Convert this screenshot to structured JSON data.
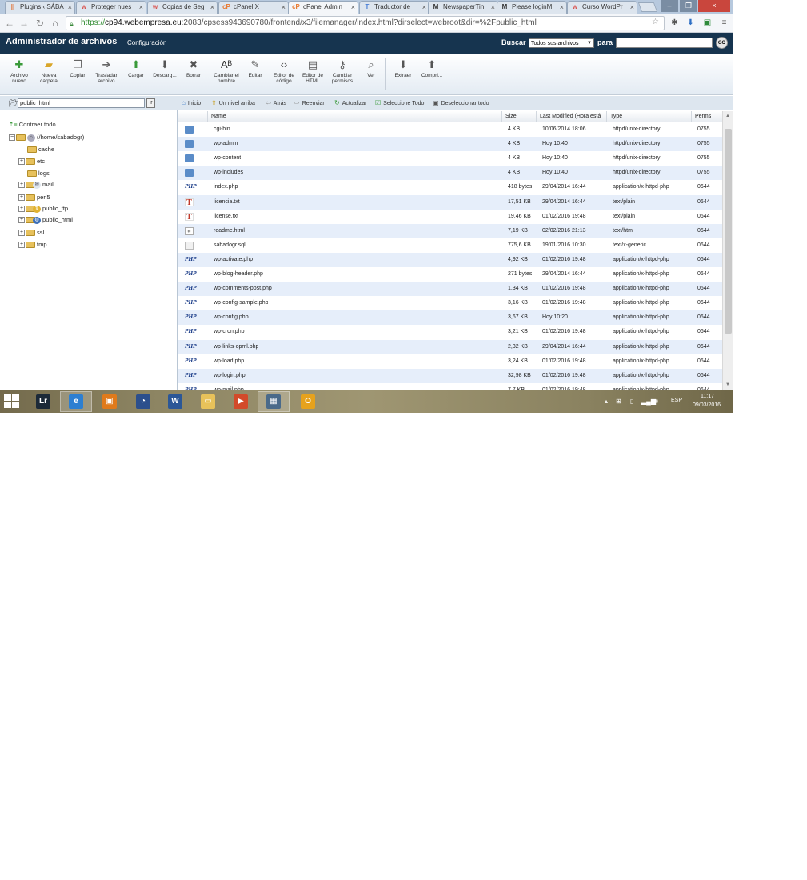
{
  "browser": {
    "tabs": [
      {
        "icon": "||",
        "label": "Plugins ‹ SÁBA",
        "icon_color": "#e26b2b"
      },
      {
        "icon": "w",
        "label": "Proteger nues",
        "icon_color": "#d9534f"
      },
      {
        "icon": "w",
        "label": "Copias de Seg",
        "icon_color": "#d9534f"
      },
      {
        "icon": "cP",
        "label": "cPanel X",
        "icon_color": "#e8772e"
      },
      {
        "icon": "cP",
        "label": "cPanel Admin",
        "icon_color": "#e8772e"
      },
      {
        "icon": "T",
        "label": "Traductor de",
        "icon_color": "#4a7fd6"
      },
      {
        "icon": "M",
        "label": "NewspaperTin",
        "icon_color": "#333333"
      },
      {
        "icon": "M",
        "label": "Please loginM",
        "icon_color": "#333333"
      },
      {
        "icon": "w",
        "label": "Curso WordPr",
        "icon_color": "#d9534f"
      }
    ],
    "active_tab": 4,
    "url": {
      "scheme": "https://",
      "host": "cp94.webempresa.eu",
      "path": ":2083/cpsess943690780/frontend/x3/filemanager/index.html?dirselect=webroot&dir=%2Fpublic_html"
    }
  },
  "header": {
    "title": "Administrador de archivos",
    "config_link": "Configuración",
    "search_label": "Buscar",
    "search_scope": "Todos sus archivos",
    "para_label": "para",
    "search_value": "",
    "go_label": "GO"
  },
  "toolbar": [
    {
      "name": "new-file",
      "label": "Archivo nuevo",
      "icon": "✚",
      "color": "#3a9a3a"
    },
    {
      "name": "new-folder",
      "label": "Nueva carpeta",
      "icon": "▰",
      "color": "#d9a62a"
    },
    {
      "name": "copy",
      "label": "Copiar",
      "icon": "❐",
      "color": "#666666"
    },
    {
      "name": "move-file",
      "label": "Trasladar archivo",
      "icon": "➔",
      "color": "#666666"
    },
    {
      "name": "upload",
      "label": "Cargar",
      "icon": "⬆",
      "color": "#3a9a3a"
    },
    {
      "name": "download",
      "label": "Descarg...",
      "icon": "⬇",
      "color": "#555555"
    },
    {
      "name": "delete",
      "label": "Borrar",
      "icon": "✖",
      "color": "#555555"
    },
    {
      "name": "rename",
      "label": "Cambiar el nombre",
      "icon": "Aᴮ",
      "color": "#333333"
    },
    {
      "name": "edit",
      "label": "Editar",
      "icon": "✎",
      "color": "#555555"
    },
    {
      "name": "code-editor",
      "label": "Editor de código",
      "icon": "‹›",
      "color": "#555555"
    },
    {
      "name": "html-editor",
      "label": "Editor de HTML",
      "icon": "▤",
      "color": "#555555"
    },
    {
      "name": "change-permissions",
      "label": "Cambiar permisos",
      "icon": "⚷",
      "color": "#555555"
    },
    {
      "name": "view",
      "label": "Ver",
      "icon": "⌕",
      "color": "#555555"
    },
    {
      "name": "extract",
      "label": "Extraer",
      "icon": "⬇",
      "color": "#555555"
    },
    {
      "name": "compress",
      "label": "Compri...",
      "icon": "⬆",
      "color": "#555555"
    }
  ],
  "left": {
    "dir_value": "public_html",
    "dir_go": "Ir",
    "collapse_all": "Contraer todo",
    "tree": [
      {
        "name": "home",
        "label": "(/home/sabadogr)",
        "level": 0,
        "exp": "−",
        "badge": ""
      },
      {
        "name": "cache",
        "label": "cache",
        "level": 1,
        "exp": "",
        "badge": ""
      },
      {
        "name": "etc",
        "label": "etc",
        "level": 1,
        "exp": "+",
        "badge": ""
      },
      {
        "name": "logs",
        "label": "logs",
        "level": 1,
        "exp": "",
        "badge": ""
      },
      {
        "name": "mail",
        "label": "mail",
        "level": 1,
        "exp": "+",
        "badge": "✉"
      },
      {
        "name": "perl5",
        "label": "perl5",
        "level": 1,
        "exp": "+",
        "badge": ""
      },
      {
        "name": "public-ftp",
        "label": "public_ftp",
        "level": 1,
        "exp": "+",
        "badge": "⇅"
      },
      {
        "name": "public-html",
        "label": "public_html",
        "level": 1,
        "exp": "+",
        "badge": "◍"
      },
      {
        "name": "ssl",
        "label": "ssl",
        "level": 1,
        "exp": "+",
        "badge": ""
      },
      {
        "name": "tmp",
        "label": "tmp",
        "level": 1,
        "exp": "+",
        "badge": ""
      }
    ]
  },
  "actions": [
    {
      "name": "home",
      "label": "Inicio",
      "icon": "⌂"
    },
    {
      "name": "up-one-level",
      "label": "Un nivel arriba",
      "icon": "⇧"
    },
    {
      "name": "back",
      "label": "Atrás",
      "icon": "⇦"
    },
    {
      "name": "forward",
      "label": "Reenviar",
      "icon": "⇨"
    },
    {
      "name": "refresh",
      "label": "Actualizar",
      "icon": "↻"
    },
    {
      "name": "select-all",
      "label": "Seleccione Todo",
      "icon": "☑"
    },
    {
      "name": "deselect-all",
      "label": "Deseleccionar todo",
      "icon": "▣"
    }
  ],
  "table": {
    "columns": [
      "Name",
      "Size",
      "Last Modified (Hora está",
      "Type",
      "Perms"
    ],
    "rows": [
      {
        "name": "cgi-bin",
        "size": "4 KB",
        "modified": "10/06/2014 18:06",
        "type": "httpd/unix-directory",
        "perms": "0755",
        "kind": "folder"
      },
      {
        "name": "wp-admin",
        "size": "4 KB",
        "modified": "Hoy 10:40",
        "type": "httpd/unix-directory",
        "perms": "0755",
        "kind": "folder"
      },
      {
        "name": "wp-content",
        "size": "4 KB",
        "modified": "Hoy 10:40",
        "type": "httpd/unix-directory",
        "perms": "0755",
        "kind": "folder"
      },
      {
        "name": "wp-includes",
        "size": "4 KB",
        "modified": "Hoy 10:40",
        "type": "httpd/unix-directory",
        "perms": "0755",
        "kind": "folder"
      },
      {
        "name": "index.php",
        "size": "418 bytes",
        "modified": "29/04/2014 16:44",
        "type": "application/x-httpd-php",
        "perms": "0644",
        "kind": "php"
      },
      {
        "name": "licencia.txt",
        "size": "17,51 KB",
        "modified": "29/04/2014 16:44",
        "type": "text/plain",
        "perms": "0644",
        "kind": "txt"
      },
      {
        "name": "license.txt",
        "size": "19,46 KB",
        "modified": "01/02/2016 19:48",
        "type": "text/plain",
        "perms": "0644",
        "kind": "txt"
      },
      {
        "name": "readme.html",
        "size": "7,19 KB",
        "modified": "02/02/2016 21:13",
        "type": "text/html",
        "perms": "0644",
        "kind": "html"
      },
      {
        "name": "sabadogr.sql",
        "size": "775,6 KB",
        "modified": "19/01/2016 10:30",
        "type": "text/x-generic",
        "perms": "0644",
        "kind": "sql"
      },
      {
        "name": "wp-activate.php",
        "size": "4,92 KB",
        "modified": "01/02/2016 19:48",
        "type": "application/x-httpd-php",
        "perms": "0644",
        "kind": "php"
      },
      {
        "name": "wp-blog-header.php",
        "size": "271 bytes",
        "modified": "29/04/2014 16:44",
        "type": "application/x-httpd-php",
        "perms": "0644",
        "kind": "php"
      },
      {
        "name": "wp-comments-post.php",
        "size": "1,34 KB",
        "modified": "01/02/2016 19:48",
        "type": "application/x-httpd-php",
        "perms": "0644",
        "kind": "php"
      },
      {
        "name": "wp-config-sample.php",
        "size": "3,16 KB",
        "modified": "01/02/2016 19:48",
        "type": "application/x-httpd-php",
        "perms": "0644",
        "kind": "php"
      },
      {
        "name": "wp-config.php",
        "size": "3,67 KB",
        "modified": "Hoy 10:20",
        "type": "application/x-httpd-php",
        "perms": "0644",
        "kind": "php"
      },
      {
        "name": "wp-cron.php",
        "size": "3,21 KB",
        "modified": "01/02/2016 19:48",
        "type": "application/x-httpd-php",
        "perms": "0644",
        "kind": "php"
      },
      {
        "name": "wp-links-opml.php",
        "size": "2,32 KB",
        "modified": "29/04/2014 16:44",
        "type": "application/x-httpd-php",
        "perms": "0644",
        "kind": "php"
      },
      {
        "name": "wp-load.php",
        "size": "3,24 KB",
        "modified": "01/02/2016 19:48",
        "type": "application/x-httpd-php",
        "perms": "0644",
        "kind": "php"
      },
      {
        "name": "wp-login.php",
        "size": "32,98 KB",
        "modified": "01/02/2016 19:48",
        "type": "application/x-httpd-php",
        "perms": "0644",
        "kind": "php"
      },
      {
        "name": "wp-mail.php",
        "size": "7,7 KB",
        "modified": "01/02/2016 19:48",
        "type": "application/x-httpd-php",
        "perms": "0644",
        "kind": "php"
      }
    ]
  },
  "taskbar": {
    "apps": [
      {
        "name": "lightroom",
        "icon": "Lr",
        "bg": "#1c2a38",
        "active": false
      },
      {
        "name": "internet-explorer",
        "icon": "e",
        "bg": "#2d7fd1",
        "active": true
      },
      {
        "name": "office",
        "icon": "▣",
        "bg": "#e07a1b",
        "active": false
      },
      {
        "name": "browser-compass",
        "icon": "◔",
        "bg": "#2c4f8c",
        "active": false
      },
      {
        "name": "word",
        "icon": "W",
        "bg": "#2b5797",
        "active": false
      },
      {
        "name": "file-explorer",
        "icon": "▭",
        "bg": "#e8c25a",
        "active": false
      },
      {
        "name": "media-app",
        "icon": "▶",
        "bg": "#d24a2a",
        "active": false
      },
      {
        "name": "window-app",
        "icon": "▦",
        "bg": "#4a6a8a",
        "active": true
      },
      {
        "name": "outlook",
        "icon": "O",
        "bg": "#e6a21c",
        "active": false
      }
    ],
    "language": "ESP",
    "time": "11:17",
    "date": "09/03/2016"
  }
}
